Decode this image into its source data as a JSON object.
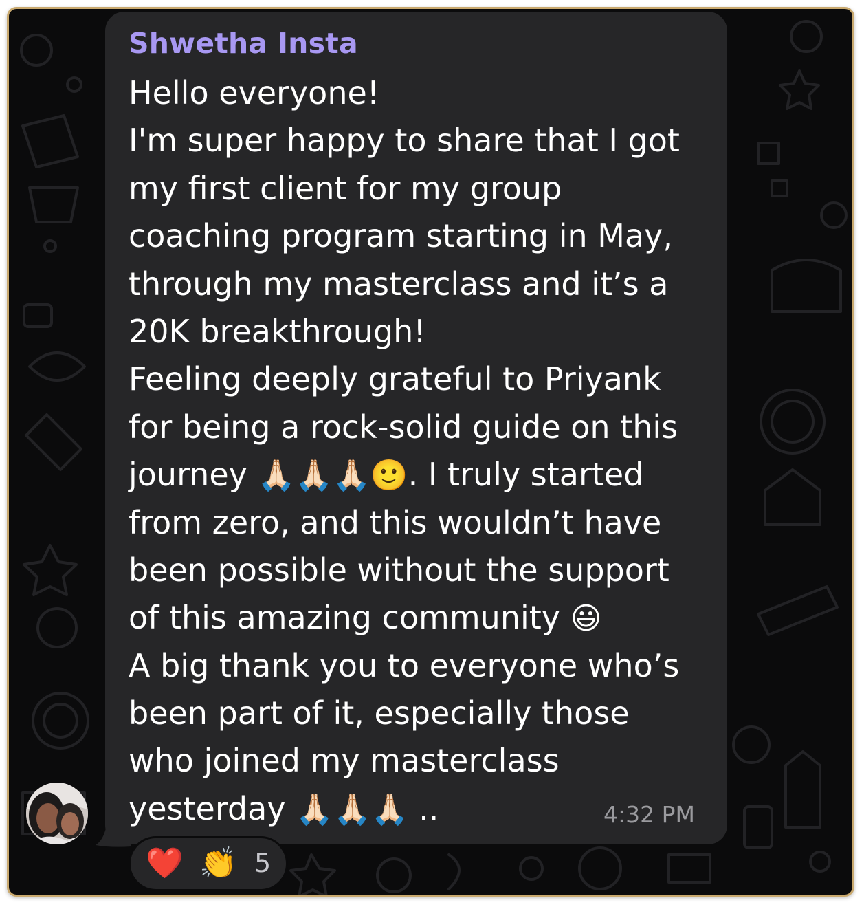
{
  "message": {
    "sender": "Shwetha Insta",
    "lines": [
      "Hello everyone!",
      "I'm super happy to share that I got",
      "my first client for my group",
      "coaching program starting in May,",
      "through my masterclass  and it’s a",
      "20K breakthrough!",
      "Feeling deeply grateful to Priyank",
      "for being a rock-solid guide on this",
      "journey",
      "🙏🏻🙏🏻🙏🏻🙂",
      ". I truly started",
      "from zero, and this wouldn’t have",
      "been possible without the support",
      "of this amazing community",
      "😃",
      "A big thank you to everyone who’s",
      "been part of it, especially those",
      "who joined my masterclass",
      "yesterday",
      "🙏🏻🙏🏻🙏🏻",
      ".."
    ],
    "time": "4:32 PM"
  },
  "reactions": {
    "heart": "❤️",
    "clap": "👏",
    "count": "5"
  },
  "icons": {
    "avatar": "avatar-photo",
    "wallpaper": "doodle-pattern"
  },
  "colors": {
    "sender_name": "#a898f2",
    "bubble_bg": "#262628",
    "chat_bg": "#0b0b0c",
    "frame_border": "#c9a96e",
    "timestamp": "#9a9a9e"
  }
}
